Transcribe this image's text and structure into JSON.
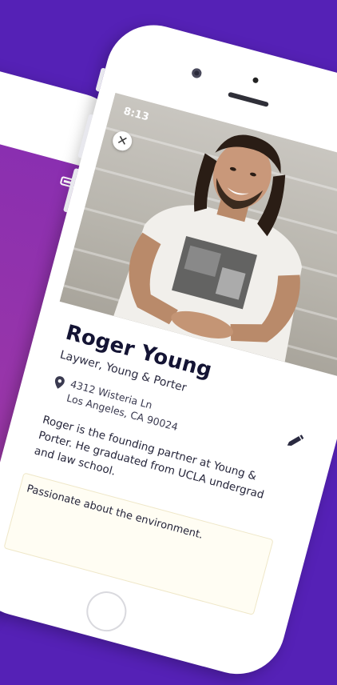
{
  "status": {
    "time": "8:13"
  },
  "profile": {
    "name": "Roger Young",
    "title": "Laywer, Young & Porter",
    "address": {
      "line1": "4312 Wisteria Ln",
      "line2": "Los Angeles, CA 90024"
    },
    "bio": "Roger is the founding partner at Young & Porter. He graduated from UCLA undergrad and law school.",
    "note": "Passionate about the environment."
  },
  "icons": {
    "close": "close-icon",
    "location": "location-pin-icon",
    "edit": "pencil-icon",
    "battery": "battery-icon",
    "signal": "signal-icon"
  },
  "colors": {
    "background": "#5521b6",
    "name_text": "#141434",
    "back_screen": "#8a2fb0",
    "note_card": "#fffdf3"
  }
}
